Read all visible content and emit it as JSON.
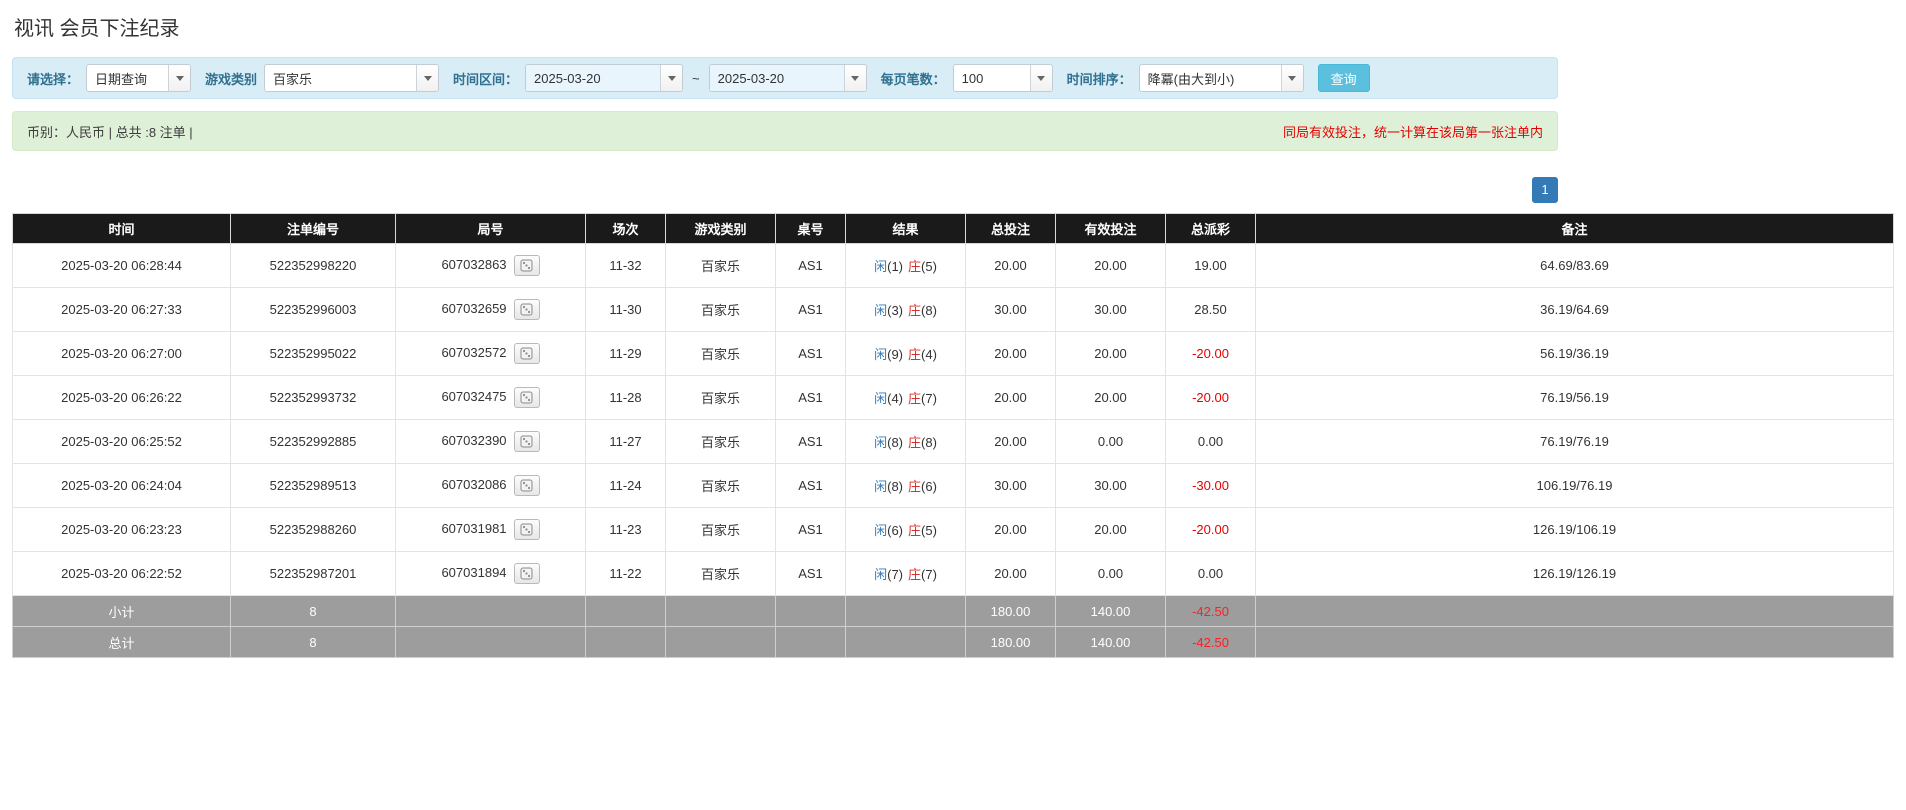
{
  "page": {
    "title": "视讯 会员下注纪录"
  },
  "filters": {
    "select_label": "请选择：",
    "select_value": "日期查询",
    "game_type_label": "游戏类别",
    "game_type_value": "百家乐",
    "date_range_label": "时间区间：",
    "date_from": "2025-03-20",
    "date_separator": "~",
    "date_to": "2025-03-20",
    "page_size_label": "每页笔数：",
    "page_size_value": "100",
    "sort_label": "时间排序：",
    "sort_value": "降冪(由大到小)",
    "search_button": "查询"
  },
  "info_bar": {
    "left": "币别：人民币 | 总共 :8 注单 |",
    "right": "同局有效投注，统一计算在该局第一张注单内"
  },
  "pagination": {
    "current": "1"
  },
  "table": {
    "headers": [
      "时间",
      "注单编号",
      "局号",
      "场次",
      "游戏类别",
      "桌号",
      "结果",
      "总投注",
      "有效投注",
      "总派彩",
      "备注"
    ],
    "rows": [
      {
        "time": "2025-03-20 06:28:44",
        "bet_id": "522352998220",
        "round": "607032863",
        "session": "11-32",
        "game": "百家乐",
        "table_no": "AS1",
        "result_xian": "闲",
        "result_xian_num": "(1)",
        "result_zhuang": "庄",
        "result_zhuang_num": "(5)",
        "total_bet": "20.00",
        "valid_bet": "20.00",
        "payout": "19.00",
        "remark": "64.69/83.69"
      },
      {
        "time": "2025-03-20 06:27:33",
        "bet_id": "522352996003",
        "round": "607032659",
        "session": "11-30",
        "game": "百家乐",
        "table_no": "AS1",
        "result_xian": "闲",
        "result_xian_num": "(3)",
        "result_zhuang": "庄",
        "result_zhuang_num": "(8)",
        "total_bet": "30.00",
        "valid_bet": "30.00",
        "payout": "28.50",
        "remark": "36.19/64.69"
      },
      {
        "time": "2025-03-20 06:27:00",
        "bet_id": "522352995022",
        "round": "607032572",
        "session": "11-29",
        "game": "百家乐",
        "table_no": "AS1",
        "result_xian": "闲",
        "result_xian_num": "(9)",
        "result_zhuang": "庄",
        "result_zhuang_num": "(4)",
        "total_bet": "20.00",
        "valid_bet": "20.00",
        "payout": "-20.00",
        "remark": "56.19/36.19"
      },
      {
        "time": "2025-03-20 06:26:22",
        "bet_id": "522352993732",
        "round": "607032475",
        "session": "11-28",
        "game": "百家乐",
        "table_no": "AS1",
        "result_xian": "闲",
        "result_xian_num": "(4)",
        "result_zhuang": "庄",
        "result_zhuang_num": "(7)",
        "total_bet": "20.00",
        "valid_bet": "20.00",
        "payout": "-20.00",
        "remark": "76.19/56.19"
      },
      {
        "time": "2025-03-20 06:25:52",
        "bet_id": "522352992885",
        "round": "607032390",
        "session": "11-27",
        "game": "百家乐",
        "table_no": "AS1",
        "result_xian": "闲",
        "result_xian_num": "(8)",
        "result_zhuang": "庄",
        "result_zhuang_num": "(8)",
        "total_bet": "20.00",
        "valid_bet": "0.00",
        "payout": "0.00",
        "remark": "76.19/76.19"
      },
      {
        "time": "2025-03-20 06:24:04",
        "bet_id": "522352989513",
        "round": "607032086",
        "session": "11-24",
        "game": "百家乐",
        "table_no": "AS1",
        "result_xian": "闲",
        "result_xian_num": "(8)",
        "result_zhuang": "庄",
        "result_zhuang_num": "(6)",
        "total_bet": "30.00",
        "valid_bet": "30.00",
        "payout": "-30.00",
        "remark": "106.19/76.19"
      },
      {
        "time": "2025-03-20 06:23:23",
        "bet_id": "522352988260",
        "round": "607031981",
        "session": "11-23",
        "game": "百家乐",
        "table_no": "AS1",
        "result_xian": "闲",
        "result_xian_num": "(6)",
        "result_zhuang": "庄",
        "result_zhuang_num": "(5)",
        "total_bet": "20.00",
        "valid_bet": "20.00",
        "payout": "-20.00",
        "remark": "126.19/106.19"
      },
      {
        "time": "2025-03-20 06:22:52",
        "bet_id": "522352987201",
        "round": "607031894",
        "session": "11-22",
        "game": "百家乐",
        "table_no": "AS1",
        "result_xian": "闲",
        "result_xian_num": "(7)",
        "result_zhuang": "庄",
        "result_zhuang_num": "(7)",
        "total_bet": "20.00",
        "valid_bet": "0.00",
        "payout": "0.00",
        "remark": "126.19/126.19"
      }
    ],
    "subtotal": {
      "label": "小计",
      "count": "8",
      "total_bet": "180.00",
      "valid_bet": "140.00",
      "payout": "-42.50"
    },
    "total": {
      "label": "总计",
      "count": "8",
      "total_bet": "180.00",
      "valid_bet": "140.00",
      "payout": "-42.50"
    }
  }
}
